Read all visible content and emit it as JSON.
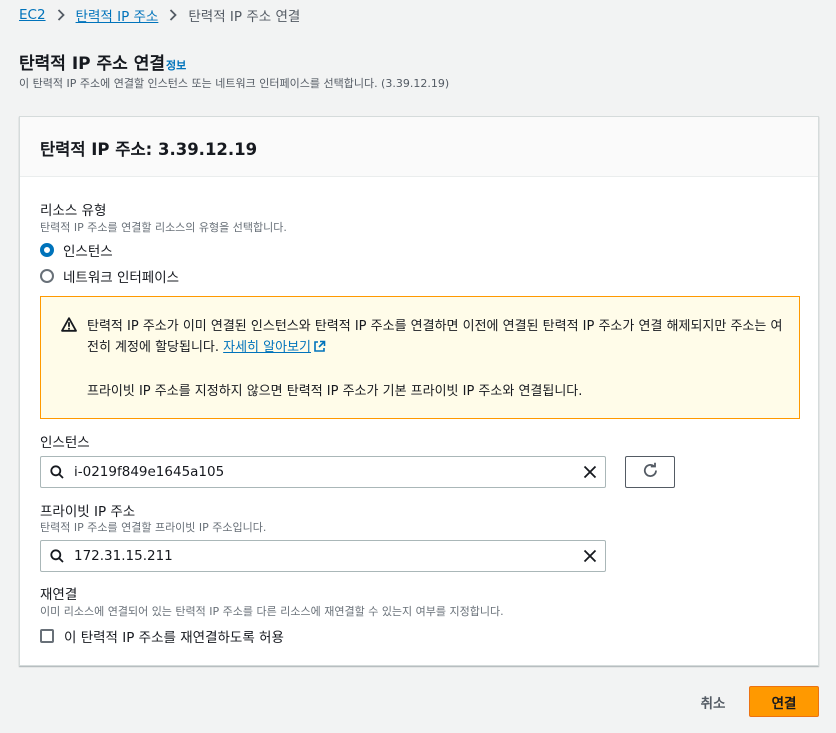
{
  "breadcrumb": {
    "items": [
      "EC2",
      "탄력적 IP 주소"
    ],
    "current": "탄력적 IP 주소 연결"
  },
  "page": {
    "title": "탄력적 IP 주소 연결",
    "info_link": "정보",
    "description": "이 탄력적 IP 주소에 연결할 인스턴스 또는 네트워크 인터페이스를 선택합니다. (3.39.12.19)"
  },
  "panel": {
    "title": "탄력적 IP 주소: 3.39.12.19"
  },
  "resource_type": {
    "label": "리소스 유형",
    "description": "탄력적 IP 주소를 연결할 리소스의 유형을 선택합니다.",
    "options": [
      {
        "label": "인스턴스",
        "checked": true
      },
      {
        "label": "네트워크 인터페이스",
        "checked": false
      }
    ]
  },
  "alert": {
    "text": "탄력적 IP 주소가 이미 연결된 인스턴스와 탄력적 IP 주소를 연결하면 이전에 연결된 탄력적 IP 주소가 연결 해제되지만 주소는 여전히 계정에 할당됩니다.",
    "link": "자세히 알아보기",
    "text2": "프라이빗 IP 주소를 지정하지 않으면 탄력적 IP 주소가 기본 프라이빗 IP 주소와 연결됩니다.",
    "icon": "warning-icon",
    "color": "#ff9900"
  },
  "instance": {
    "label": "인스턴스",
    "value": "i-0219f849e1645a105"
  },
  "private_ip": {
    "label": "프라이빗 IP 주소",
    "description": "탄력적 IP 주소를 연결할 프라이빗 IP 주소입니다.",
    "value": "172.31.15.211"
  },
  "reassociation": {
    "label": "재연결",
    "description": "이미 리소스에 연결되어 있는 탄력적 IP 주소를 다른 리소스에 재연결할 수 있는지 여부를 지정합니다.",
    "checkbox_label": "이 탄력적 IP 주소를 재연결하도록 허용",
    "checked": false
  },
  "footer": {
    "cancel_label": "취소",
    "submit_label": "연결"
  },
  "colors": {
    "primary": "#ff9900",
    "link": "#0073bb"
  }
}
